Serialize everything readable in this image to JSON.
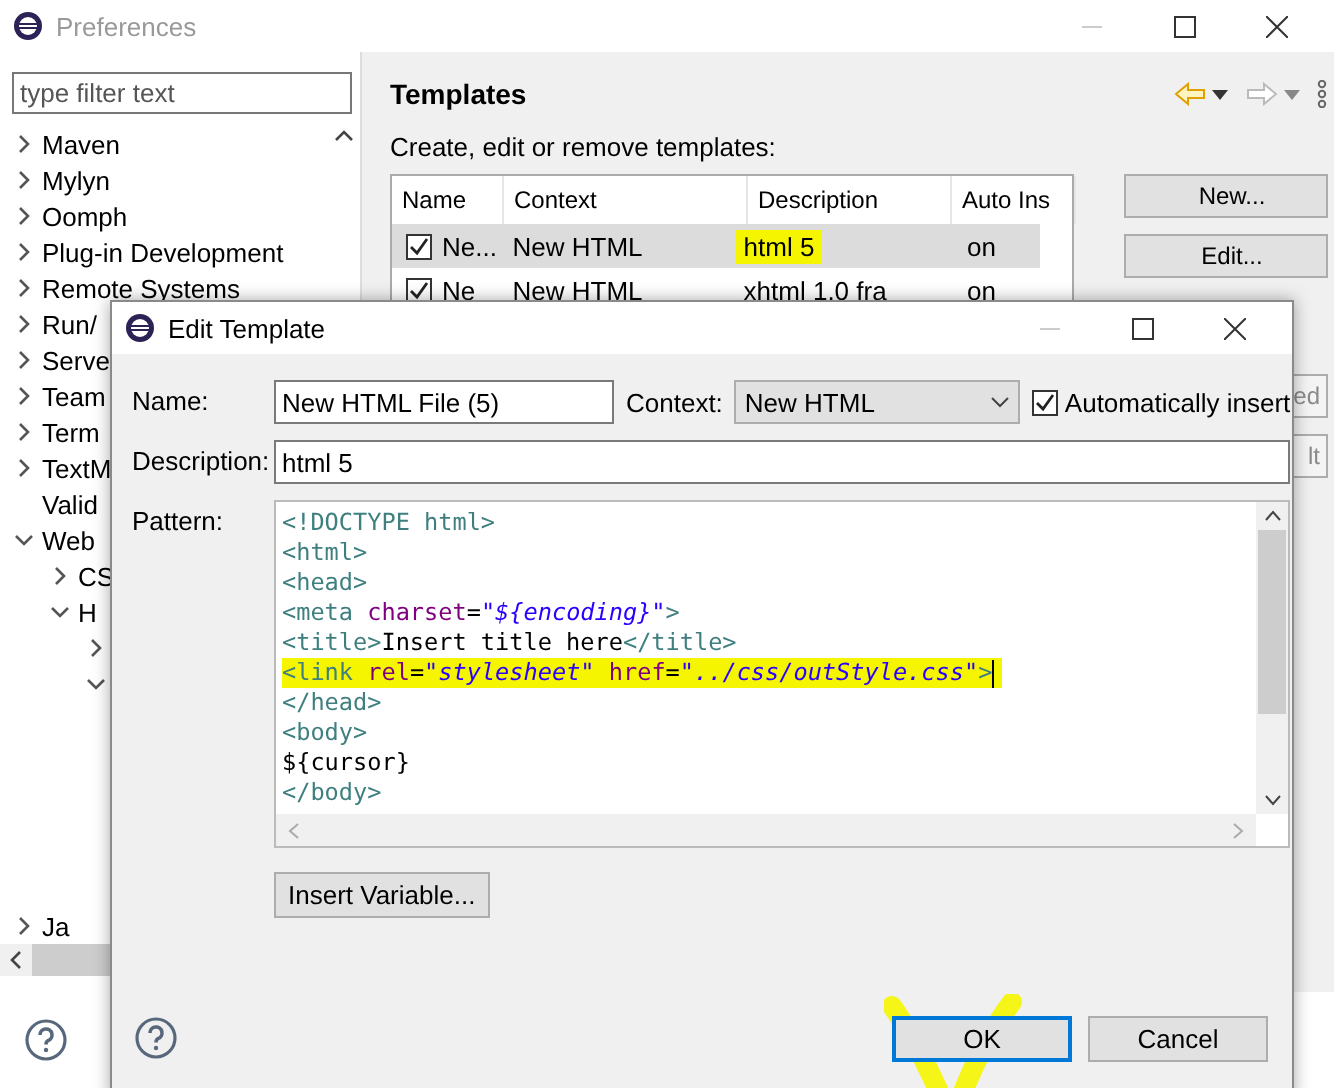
{
  "window": {
    "title": "Preferences"
  },
  "filter": {
    "placeholder": "type filter text"
  },
  "tree": [
    {
      "label": "Maven",
      "kind": "folder",
      "expanded": false
    },
    {
      "label": "Mylyn",
      "kind": "folder",
      "expanded": false
    },
    {
      "label": "Oomph",
      "kind": "folder",
      "expanded": false
    },
    {
      "label": "Plug-in Development",
      "kind": "folder",
      "expanded": false
    },
    {
      "label": "Remote Systems",
      "kind": "folder",
      "expanded": false
    },
    {
      "label": "Run/",
      "kind": "folder",
      "expanded": false
    },
    {
      "label": "Serve",
      "kind": "folder",
      "expanded": false
    },
    {
      "label": "Team",
      "kind": "folder",
      "expanded": false
    },
    {
      "label": "Term",
      "kind": "folder",
      "expanded": false
    },
    {
      "label": "TextM",
      "kind": "folder",
      "expanded": false
    },
    {
      "label": "Valid",
      "kind": "leaf"
    },
    {
      "label": "Web",
      "kind": "folder",
      "expanded": true,
      "children": [
        {
          "label": "CS",
          "kind": "folder",
          "expanded": false
        },
        {
          "label": "H",
          "kind": "folder",
          "expanded": true,
          "children": [
            {
              "kind": "folder",
              "expanded": false
            },
            {
              "kind": "folder",
              "expanded": true
            }
          ]
        }
      ]
    },
    {
      "label": "Ja",
      "kind": "folder",
      "expanded": false
    }
  ],
  "page": {
    "title": "Templates",
    "subtitle": "Create, edit or remove templates:"
  },
  "table": {
    "columns": [
      "Name",
      "Context",
      "Description",
      "Auto Ins"
    ],
    "rows": [
      {
        "name": "Ne...",
        "context": "New HTML",
        "description": "html 5",
        "auto_insert": "on",
        "checked": true,
        "selected": true,
        "description_highlighted": true
      },
      {
        "name": "Ne",
        "context": "New HTML",
        "description": "xhtml 1.0 fra",
        "auto_insert": "on",
        "checked": true,
        "selected": false,
        "description_highlighted": false
      }
    ]
  },
  "side_buttons": [
    {
      "label": "New...",
      "disabled": false
    },
    {
      "label": "Edit...",
      "disabled": false
    },
    {
      "label": "ed",
      "disabled": true
    },
    {
      "label": "lt",
      "disabled": true
    }
  ],
  "dialog": {
    "title": "Edit Template",
    "name_label": "Name:",
    "name_value": "New HTML File (5)",
    "context_label": "Context:",
    "context_value": "New HTML",
    "auto_insert": {
      "label": "Automatically insert",
      "checked": true
    },
    "description_label": "Description:",
    "description_value": "html 5",
    "pattern_label": "Pattern:",
    "pattern": [
      {
        "highlighted": false,
        "cursor": false,
        "segments": [
          {
            "kind": "tag",
            "text": "<!DOCTYPE html>"
          }
        ]
      },
      {
        "highlighted": false,
        "cursor": false,
        "segments": [
          {
            "kind": "tag",
            "text": "<html>"
          }
        ]
      },
      {
        "highlighted": false,
        "cursor": false,
        "segments": [
          {
            "kind": "tag",
            "text": "<head>"
          }
        ]
      },
      {
        "highlighted": false,
        "cursor": false,
        "segments": [
          {
            "kind": "tag",
            "text": "<meta"
          },
          {
            "kind": "attr",
            "text": " charset"
          },
          {
            "kind": "text",
            "text": "="
          },
          {
            "kind": "value",
            "text": "\"${encoding}\""
          },
          {
            "kind": "tag",
            "text": ">"
          }
        ]
      },
      {
        "highlighted": false,
        "cursor": false,
        "segments": [
          {
            "kind": "tag",
            "text": "<title>"
          },
          {
            "kind": "text",
            "text": "Insert title here"
          },
          {
            "kind": "tag",
            "text": "</title>"
          }
        ]
      },
      {
        "highlighted": true,
        "cursor": true,
        "segments": [
          {
            "kind": "tag",
            "text": "<link"
          },
          {
            "kind": "attr",
            "text": " rel"
          },
          {
            "kind": "text",
            "text": "="
          },
          {
            "kind": "value",
            "text": "\"stylesheet\""
          },
          {
            "kind": "attr",
            "text": " href"
          },
          {
            "kind": "text",
            "text": "="
          },
          {
            "kind": "value",
            "text": "\"../css/outStyle.css\""
          },
          {
            "kind": "tag",
            "text": ">"
          }
        ]
      },
      {
        "highlighted": false,
        "cursor": false,
        "segments": [
          {
            "kind": "tag",
            "text": "</head>"
          }
        ]
      },
      {
        "highlighted": false,
        "cursor": false,
        "segments": [
          {
            "kind": "tag",
            "text": "<body>"
          }
        ]
      },
      {
        "highlighted": false,
        "cursor": false,
        "segments": [
          {
            "kind": "text",
            "text": "${cursor}"
          }
        ]
      },
      {
        "highlighted": false,
        "cursor": false,
        "segments": [
          {
            "kind": "tag",
            "text": "</body>"
          }
        ]
      }
    ],
    "insert_variable": "Insert Variable...",
    "buttons": [
      {
        "label": "OK",
        "default": true
      },
      {
        "label": "Cancel",
        "default": false
      }
    ]
  }
}
